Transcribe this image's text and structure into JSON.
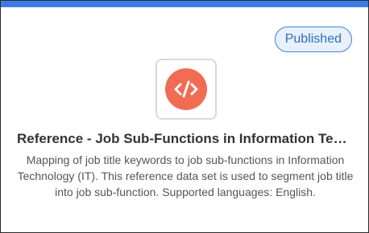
{
  "card": {
    "status": "Published",
    "icon": "code-icon",
    "title": "Reference - Job Sub-Functions in Information Technology (IT)",
    "description": "Mapping of job title keywords to job sub-functions in Information Technology (IT). This reference data set is used to segment job title into job sub-function. Supported languages: English."
  },
  "colors": {
    "accent_bar": "#3b7be8",
    "badge_border": "#3f7fd6",
    "badge_bg": "#e7f0fb",
    "badge_text": "#2f6fc0",
    "icon_circle": "#f26b53"
  }
}
